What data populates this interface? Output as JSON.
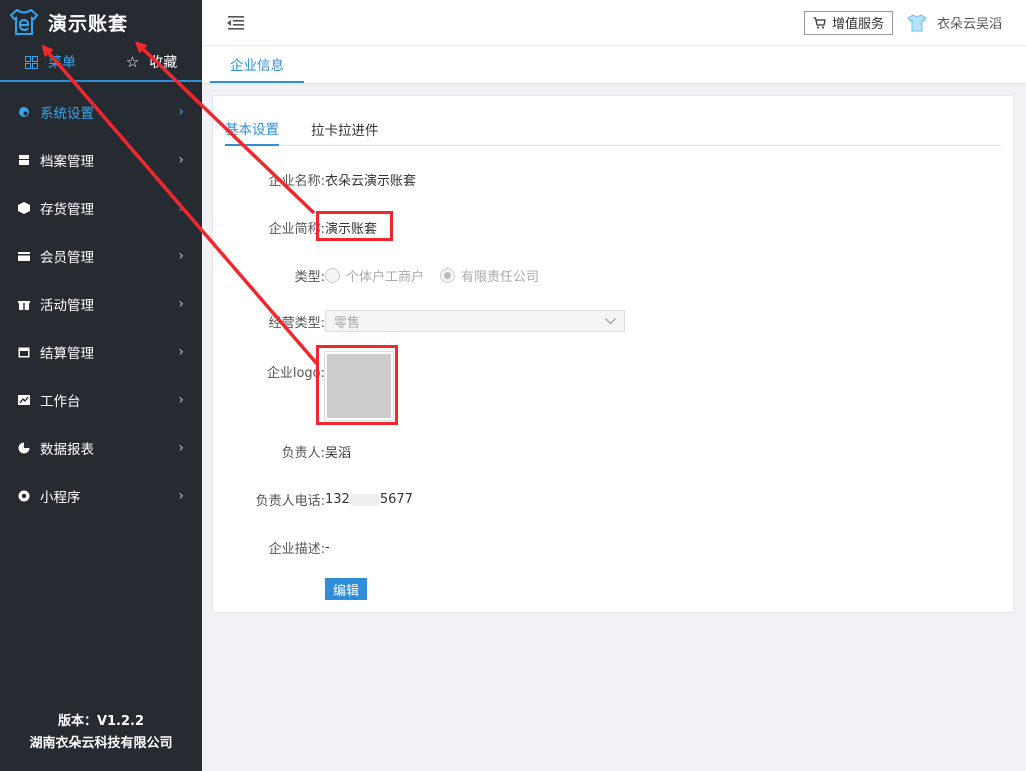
{
  "brand": {
    "title": "演示账套"
  },
  "side_tabs": [
    {
      "label": "菜单",
      "icon": "grid-icon"
    },
    {
      "label": "收藏",
      "icon": "star-icon"
    }
  ],
  "menu": [
    {
      "label": "系统设置",
      "icon": "settings-icon",
      "active": true
    },
    {
      "label": "档案管理",
      "icon": "archive-icon"
    },
    {
      "label": "存货管理",
      "icon": "box-icon"
    },
    {
      "label": "会员管理",
      "icon": "card-icon"
    },
    {
      "label": "活动管理",
      "icon": "gift-icon"
    },
    {
      "label": "结算管理",
      "icon": "calendar-icon"
    },
    {
      "label": "工作台",
      "icon": "chart-icon"
    },
    {
      "label": "数据报表",
      "icon": "pie-icon"
    },
    {
      "label": "小程序",
      "icon": "link-icon"
    }
  ],
  "footer": {
    "version": "版本：V1.2.2",
    "company": "湖南衣朵云科技有限公司"
  },
  "header": {
    "vas_label": "增值服务",
    "user_name": "衣朵云吴滔"
  },
  "page_tabs": [
    {
      "label": "企业信息"
    }
  ],
  "inner_tabs": [
    {
      "label": "基本设置",
      "active": true
    },
    {
      "label": "拉卡拉进件"
    }
  ],
  "form": {
    "company_name_label": "企业名称:",
    "company_name": "衣朵云演示账套",
    "short_name_label": "企业简称:",
    "short_name": "演示账套",
    "type_label": "类型:",
    "type_options": [
      "个体户工商户",
      "有限责任公司"
    ],
    "type_selected": "有限责任公司",
    "biz_type_label": "经营类型:",
    "biz_type": "零售",
    "logo_label": "企业logo:",
    "owner_label": "负责人:",
    "owner": "吴滔",
    "phone_label": "负责人电话:",
    "phone_prefix": "132",
    "phone_suffix": "5677",
    "desc_label": "企业描述:",
    "desc": "-",
    "edit_label": "编辑"
  },
  "colors": {
    "sidebar_bg": "#262b31",
    "accent": "#2e8fd8",
    "annotation": "#f0282d"
  }
}
